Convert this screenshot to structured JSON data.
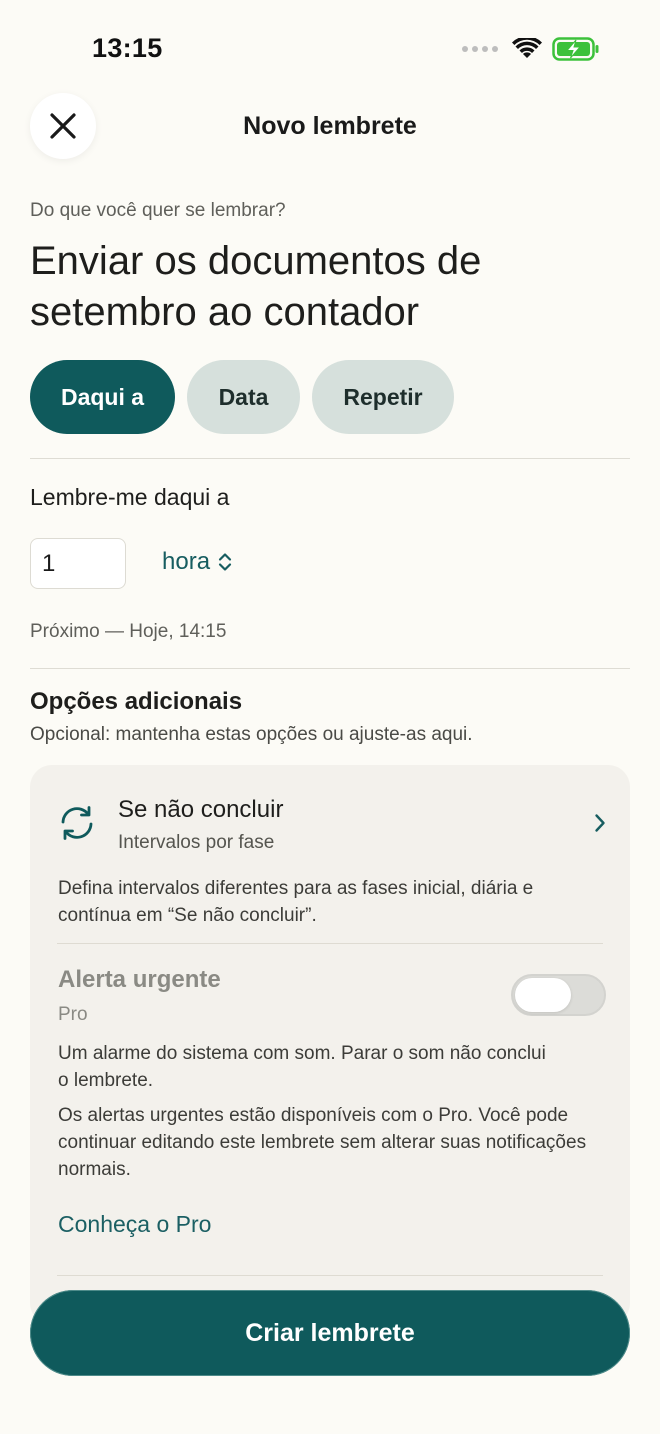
{
  "status_bar": {
    "time": "13:15"
  },
  "header": {
    "title": "Novo lembrete",
    "close_icon": "close-icon"
  },
  "prompt": {
    "label": "Do que você quer se lembrar?",
    "title_line1": "Enviar os documentos de",
    "title_line2": "setembro ao contador"
  },
  "modes": [
    {
      "label": "Daqui a",
      "active": true
    },
    {
      "label": "Data",
      "active": false
    },
    {
      "label": "Repetir",
      "active": false
    }
  ],
  "relative": {
    "label": "Lembre-me daqui a",
    "quantity": "1",
    "unit": "hora",
    "next": "Próximo — Hoje, 14:15"
  },
  "options": {
    "title": "Opções adicionais",
    "subtitle": "Opcional: mantenha estas opções ou ajuste-as aqui.",
    "if_not_done": {
      "title": "Se não concluir",
      "subtitle": "Intervalos por fase",
      "description": "Defina intervalos diferentes para as fases inicial, diária e contínua em “Se não concluir”."
    },
    "urgent": {
      "title": "Alerta urgente",
      "badge": "Pro",
      "enabled": false,
      "description_line1": "Um alarme do sistema com som. Parar o som não conclui",
      "description_line2": "o lembrete.",
      "pro_note": "Os alertas urgentes estão disponíveis com o Pro. Você pode continuar editando este lembrete sem alterar suas notificações normais.",
      "link": "Conheça o Pro"
    }
  },
  "footer": {
    "create_label": "Criar lembrete"
  },
  "colors": {
    "accent": "#0f5a5c",
    "background": "#fcfbf6",
    "chip_inactive": "#d6e0dc",
    "card": "#f3f1ec",
    "battery": "#3cc13b"
  }
}
